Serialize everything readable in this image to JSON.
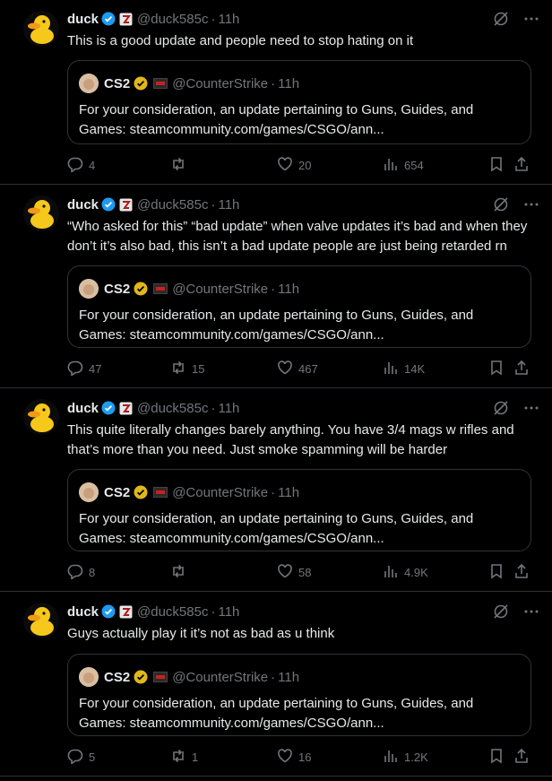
{
  "tweets": [
    {
      "name": "duck",
      "handle": "@duck585c",
      "time": "11h",
      "text": "This is a good update and people need to stop hating on it",
      "quote": {
        "name": "CS2",
        "handle": "@CounterStrike",
        "time": "11h",
        "text": "For your consideration, an update pertaining to Guns, Guides, and Games: steamcommunity.com/games/CSGO/ann..."
      },
      "replies": "4",
      "reposts": "",
      "likes": "20",
      "views": "654"
    },
    {
      "name": "duck",
      "handle": "@duck585c",
      "time": "11h",
      "text": "“Who asked for this” “bad update” when valve updates it’s bad and when they don’t it’s also bad, this isn’t a bad update people are just being retarded rn",
      "quote": {
        "name": "CS2",
        "handle": "@CounterStrike",
        "time": "11h",
        "text": "For your consideration, an update pertaining to Guns, Guides, and Games: steamcommunity.com/games/CSGO/ann..."
      },
      "replies": "47",
      "reposts": "15",
      "likes": "467",
      "views": "14K"
    },
    {
      "name": "duck",
      "handle": "@duck585c",
      "time": "11h",
      "text": "This quite literally changes barely anything. You have 3/4 mags w rifles and that’s more than you need. Just smoke spamming will be harder",
      "quote": {
        "name": "CS2",
        "handle": "@CounterStrike",
        "time": "11h",
        "text": "For your consideration, an update pertaining to Guns, Guides, and Games: steamcommunity.com/games/CSGO/ann..."
      },
      "replies": "8",
      "reposts": "",
      "likes": "58",
      "views": "4.9K"
    },
    {
      "name": "duck",
      "handle": "@duck585c",
      "time": "11h",
      "text": "Guys actually play it it’s not as bad as u think",
      "quote": {
        "name": "CS2",
        "handle": "@CounterStrike",
        "time": "11h",
        "text": "For your consideration, an update pertaining to Guns, Guides, and Games: steamcommunity.com/games/CSGO/ann..."
      },
      "replies": "5",
      "reposts": "1",
      "likes": "16",
      "views": "1.2K"
    }
  ],
  "icons": {
    "verified": "verified-badge-icon",
    "affiliate": "affiliate-badge-icon",
    "grok": "grok-icon",
    "more": "more-icon",
    "reply": "reply-icon",
    "repost": "repost-icon",
    "like": "like-icon",
    "views": "views-icon",
    "bookmark": "bookmark-icon",
    "share": "share-icon"
  },
  "colors": {
    "background": "#000000",
    "text": "#e7e9ea",
    "muted": "#71767b",
    "border": "#2f3336",
    "verified": "#1d9bf0",
    "gold": "#e2b719"
  }
}
